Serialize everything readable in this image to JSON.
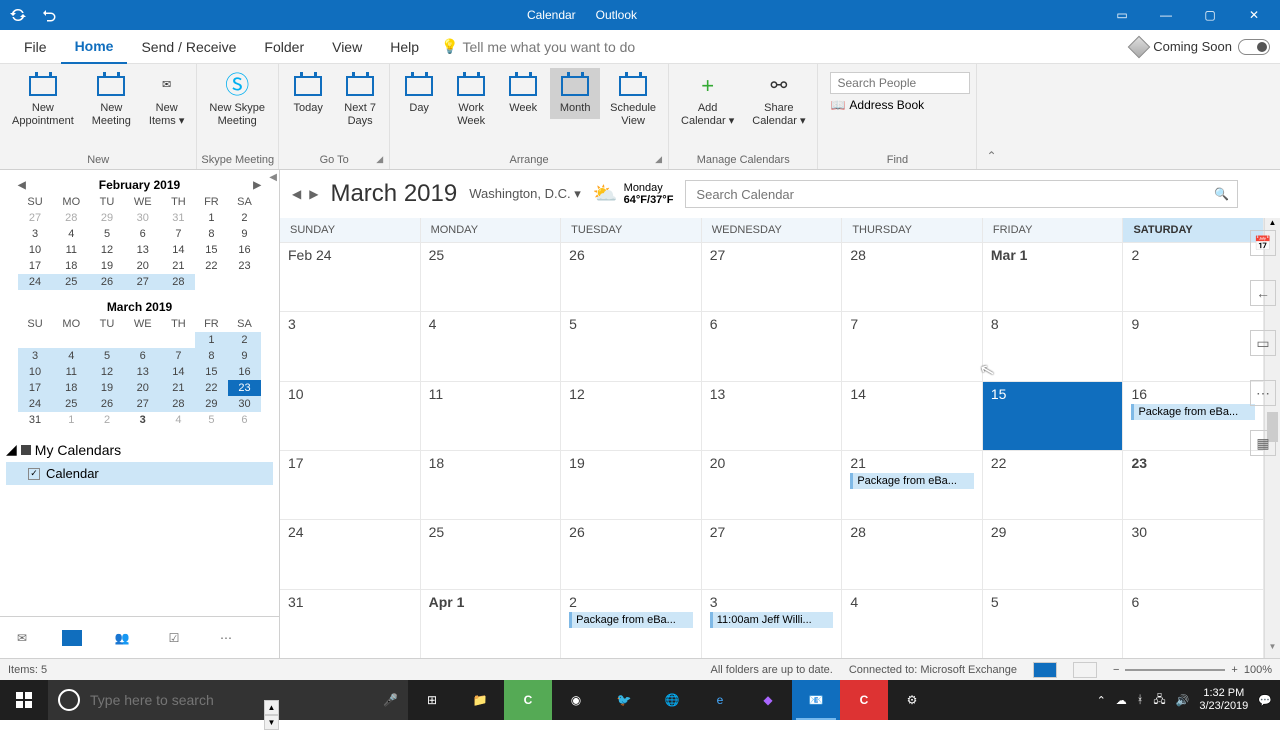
{
  "title_bar": {
    "left_title": "Calendar",
    "right_title": "Outlook"
  },
  "menu_tabs": {
    "file": "File",
    "home": "Home",
    "send_receive": "Send / Receive",
    "folder": "Folder",
    "view": "View",
    "help": "Help",
    "tell_me": "Tell me what you want to do",
    "coming_soon": "Coming Soon"
  },
  "ribbon": {
    "new": {
      "appointment": "New\nAppointment",
      "meeting": "New\nMeeting",
      "items": "New\nItems ▾",
      "label": "New"
    },
    "skype": {
      "btn": "New Skype\nMeeting",
      "label": "Skype Meeting"
    },
    "goto": {
      "today": "Today",
      "next7": "Next 7\nDays",
      "label": "Go To"
    },
    "arrange": {
      "day": "Day",
      "work_week": "Work\nWeek",
      "week": "Week",
      "month": "Month",
      "schedule": "Schedule\nView",
      "label": "Arrange"
    },
    "manage": {
      "add": "Add\nCalendar ▾",
      "share": "Share\nCalendar ▾",
      "label": "Manage Calendars"
    },
    "find": {
      "search_placeholder": "Search People",
      "address_book": "Address Book",
      "label": "Find"
    }
  },
  "minical1": {
    "title": "February 2019",
    "dow": [
      "SU",
      "MO",
      "TU",
      "WE",
      "TH",
      "FR",
      "SA"
    ],
    "rows": [
      [
        "27",
        "28",
        "29",
        "30",
        "31",
        "1",
        "2"
      ],
      [
        "3",
        "4",
        "5",
        "6",
        "7",
        "8",
        "9"
      ],
      [
        "10",
        "11",
        "12",
        "13",
        "14",
        "15",
        "16"
      ],
      [
        "17",
        "18",
        "19",
        "20",
        "21",
        "22",
        "23"
      ],
      [
        "24",
        "25",
        "26",
        "27",
        "28",
        "",
        ""
      ]
    ]
  },
  "minical2": {
    "title": "March 2019",
    "dow": [
      "SU",
      "MO",
      "TU",
      "WE",
      "TH",
      "FR",
      "SA"
    ],
    "rows": [
      [
        "",
        "",
        "",
        "",
        "",
        "1",
        "2"
      ],
      [
        "3",
        "4",
        "5",
        "6",
        "7",
        "8",
        "9"
      ],
      [
        "10",
        "11",
        "12",
        "13",
        "14",
        "15",
        "16"
      ],
      [
        "17",
        "18",
        "19",
        "20",
        "21",
        "22",
        "23"
      ],
      [
        "24",
        "25",
        "26",
        "27",
        "28",
        "29",
        "30"
      ],
      [
        "31",
        "1",
        "2",
        "3",
        "4",
        "5",
        "6"
      ]
    ]
  },
  "cal_list": {
    "group": "My Calendars",
    "item1": "Calendar"
  },
  "cal_header": {
    "title": "March 2019",
    "location": "Washington,  D.C. ▾",
    "weather_day": "Monday",
    "weather_temp": "64°F/37°F",
    "search_placeholder": "Search Calendar"
  },
  "dow_full": [
    "SUNDAY",
    "MONDAY",
    "TUESDAY",
    "WEDNESDAY",
    "THURSDAY",
    "FRIDAY",
    "SATURDAY"
  ],
  "grid": {
    "r0": [
      "Feb 24",
      "25",
      "26",
      "27",
      "28",
      "Mar 1",
      "2"
    ],
    "r1": [
      "3",
      "4",
      "5",
      "6",
      "7",
      "8",
      "9"
    ],
    "r2": [
      "10",
      "11",
      "12",
      "13",
      "14",
      "15",
      "16"
    ],
    "r3": [
      "17",
      "18",
      "19",
      "20",
      "21",
      "22",
      "23"
    ],
    "r4": [
      "24",
      "25",
      "26",
      "27",
      "28",
      "29",
      "30"
    ],
    "r5": [
      "31",
      "Apr 1",
      "2",
      "3",
      "4",
      "5",
      "6"
    ]
  },
  "events": {
    "e1": "Package from eBa...",
    "e2": "Package from eBa...",
    "e3": "Package from eBa...",
    "e4": "11:00am Jeff Willi..."
  },
  "status": {
    "items": "Items: 5",
    "folders": "All folders are up to date.",
    "connected": "Connected to: Microsoft Exchange",
    "zoom": "100%"
  },
  "taskbar": {
    "search_placeholder": "Type here to search",
    "time": "1:32 PM",
    "date": "3/23/2019"
  }
}
